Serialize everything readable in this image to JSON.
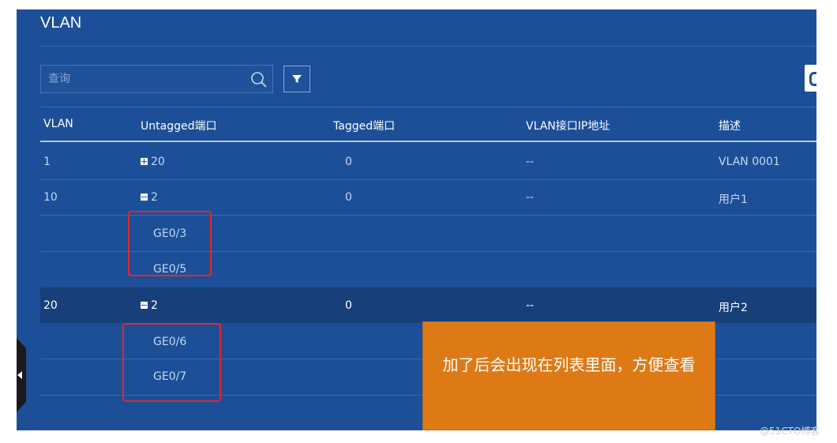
{
  "header": {
    "title": "VLAN"
  },
  "search": {
    "placeholder": "查询"
  },
  "table": {
    "columns": [
      "VLAN",
      "Untagged端口",
      "Tagged端口",
      "VLAN接口IP地址",
      "描述"
    ],
    "rows": [
      {
        "vlan": "1",
        "untagged": "20",
        "tagged": "0",
        "ip": "--",
        "desc": "VLAN 0001",
        "expand": "plus"
      },
      {
        "vlan": "10",
        "untagged": "2",
        "tagged": "0",
        "ip": "--",
        "desc": "用户1",
        "expand": "minus",
        "ports": [
          "GE0/3",
          "GE0/5"
        ]
      },
      {
        "vlan": "20",
        "untagged": "2",
        "tagged": "0",
        "ip": "--",
        "desc": "用户2",
        "expand": "minus",
        "ports": [
          "GE0/6",
          "GE0/7"
        ]
      }
    ]
  },
  "callout": {
    "text": "加了后会出现在列表里面，方便查看"
  },
  "watermark": {
    "text": "@51CTO博客"
  },
  "colors": {
    "panel": "#1c4f98",
    "selected_row": "#173f7a",
    "callout": "#de7a16",
    "highlight": "#e5262b"
  }
}
